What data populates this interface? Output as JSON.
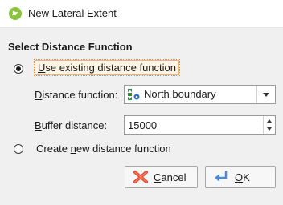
{
  "window": {
    "title": "New Lateral Extent",
    "icon": "leapfrog-app-icon"
  },
  "dialog": {
    "section_heading": "Select Distance Function",
    "option_existing": {
      "prefix": "",
      "accel": "U",
      "rest": "se existing distance function",
      "checked": true
    },
    "distance_function": {
      "label_accel": "D",
      "label_rest": "istance function:",
      "selected": "North boundary",
      "selected_icon": "distance-function-icon"
    },
    "buffer_distance": {
      "label_accel": "B",
      "label_rest": "uffer distance:",
      "value": "15000"
    },
    "option_new": {
      "prefix": "Create ",
      "accel": "n",
      "rest": "ew distance function",
      "checked": false
    }
  },
  "buttons": {
    "cancel": {
      "accel": "C",
      "rest": "ancel",
      "icon": "cancel-x-icon"
    },
    "ok": {
      "accel": "O",
      "rest": "K",
      "icon": "ok-arrow-icon"
    }
  },
  "colors": {
    "app_icon": "#8cc43f",
    "dialog_bg": "#f0f0f0",
    "focus_border": "#f1b26b",
    "cancel_icon": "#e24a2f",
    "ok_icon": "#4a8ad8"
  }
}
